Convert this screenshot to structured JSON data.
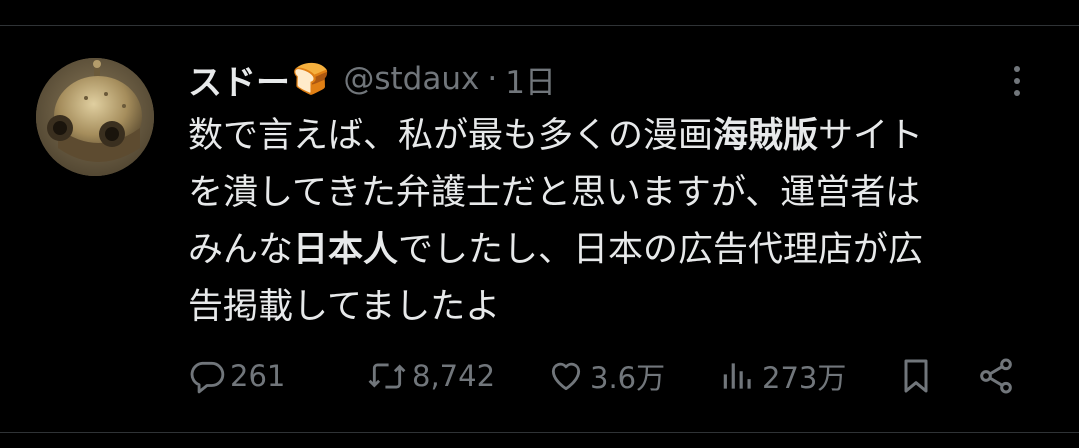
{
  "post": {
    "display_name": "スドー",
    "name_emoji": "🍞",
    "handle": "@stdaux",
    "separator": "·",
    "time": "1日",
    "text_parts": {
      "p1": "数で言えば、私が最も多くの漫画",
      "p2": "海賊版",
      "p3": "サイト",
      "p4": "を潰してきた弁護士だと思いますが、運営者は",
      "p5": "みんな",
      "p6": "日本人",
      "p7": "でしたし、日本の広告代理店が広",
      "p8": "告掲載してましたよ"
    }
  },
  "actions": {
    "replies": "261",
    "reposts": "8,742",
    "likes": "3.6万",
    "views": "273万"
  },
  "icons": {
    "reply": "comment-bubble-icon",
    "repost": "repost-arrows-icon",
    "like": "heart-icon",
    "views": "bar-chart-icon",
    "bookmark": "bookmark-icon",
    "share": "share-icon",
    "more": "three-dots-vertical-icon"
  },
  "colors": {
    "background": "#000000",
    "text": "#e7e9ea",
    "muted": "#71767b"
  }
}
